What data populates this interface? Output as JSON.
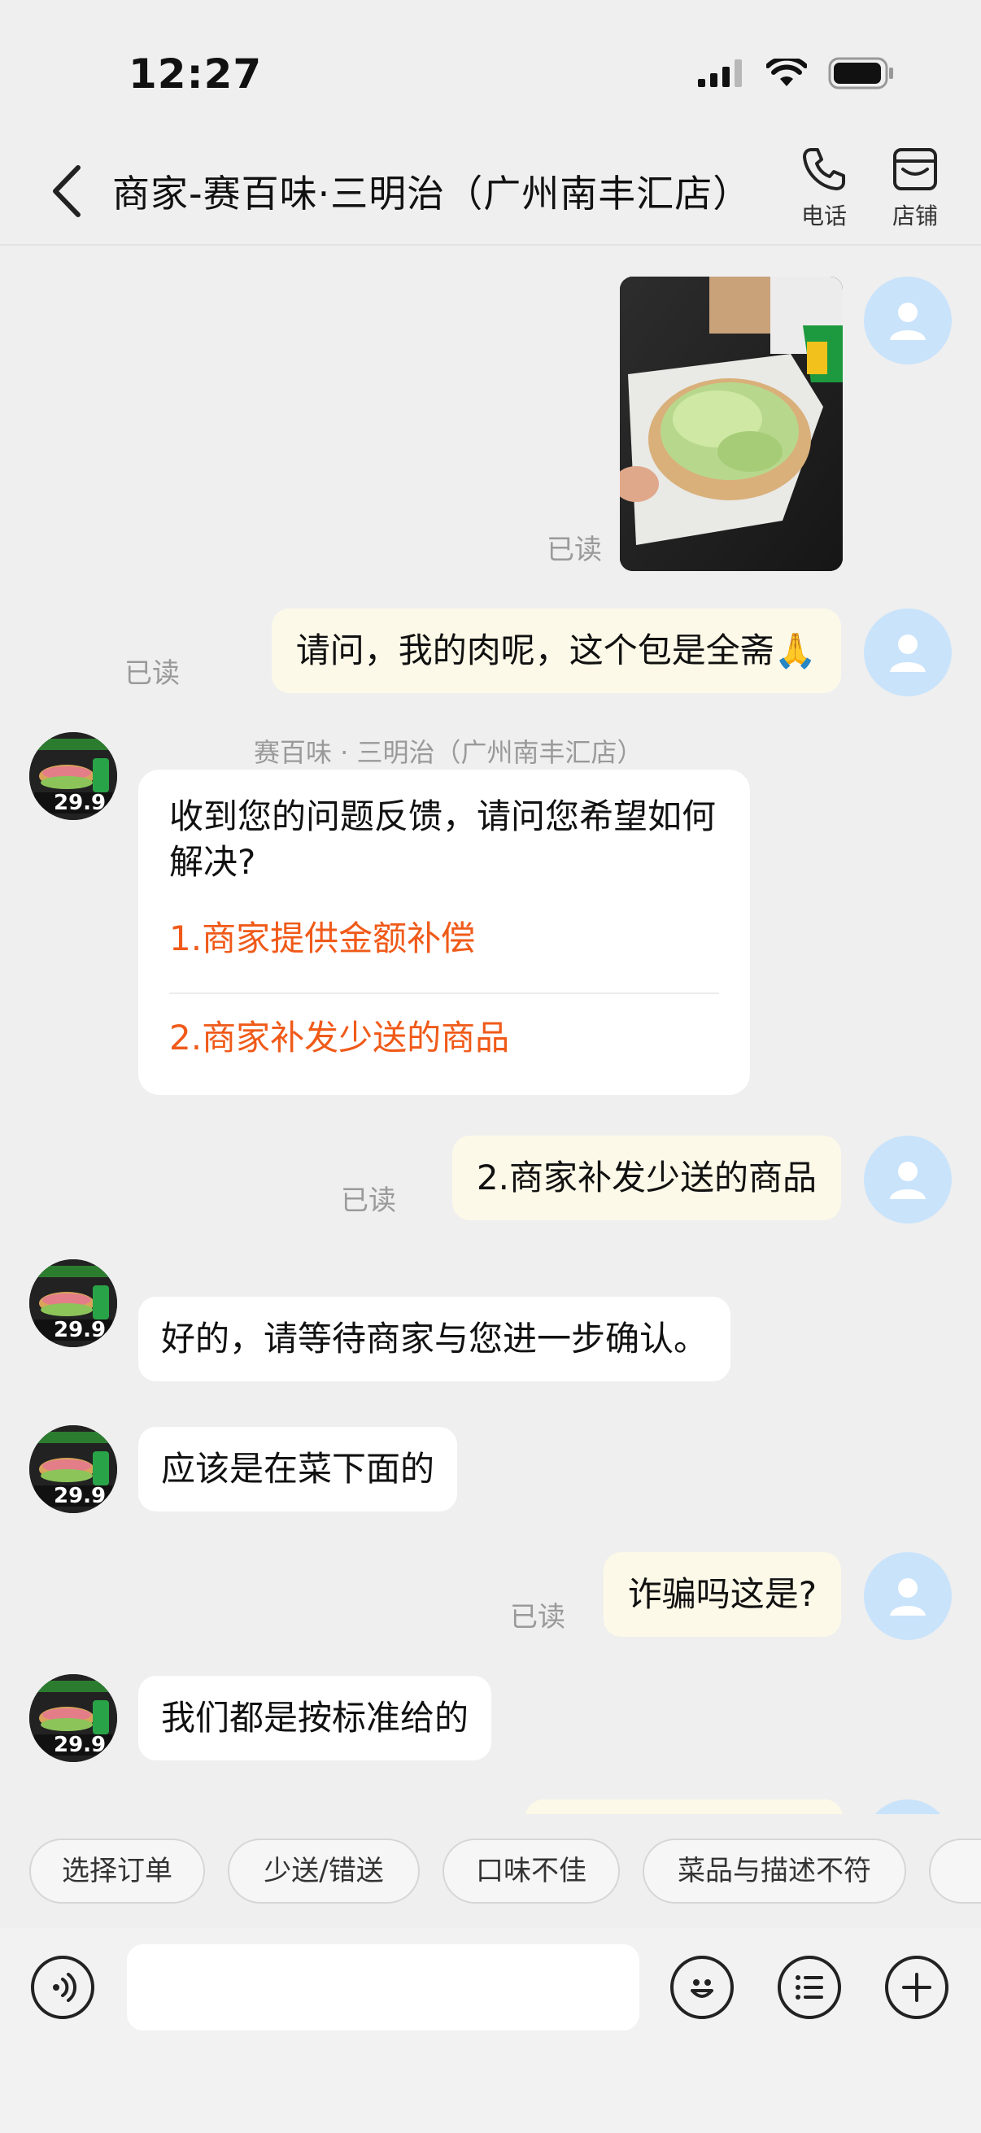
{
  "status_bar": {
    "time": "12:27"
  },
  "header": {
    "title": "商家-赛百味·三明治（广州南丰汇店）",
    "call_label": "电话",
    "shop_label": "店铺"
  },
  "chat": {
    "read_label": "已读",
    "messages": [
      {
        "from": "user",
        "kind": "image",
        "read": "已读"
      },
      {
        "from": "user",
        "text": "请问，我的肉呢，这个包是全斋🙏",
        "read": "已读"
      },
      {
        "from": "shop",
        "kind": "card",
        "sender": "赛百味 · 三明治（广州南丰汇店）",
        "question": "收到您的问题反馈，请问您希望如何解决?",
        "options": [
          "1.商家提供金额补偿",
          "2.商家补发少送的商品"
        ]
      },
      {
        "from": "user",
        "text": "2.商家补发少送的商品",
        "read": "已读"
      },
      {
        "from": "shop",
        "text": "好的，请等待商家与您进一步确认。"
      },
      {
        "from": "shop",
        "text": "应该是在菜下面的"
      },
      {
        "from": "user",
        "text": "诈骗吗这是?",
        "read": "已读"
      },
      {
        "from": "shop",
        "text": "我们都是按标准给的"
      }
    ],
    "shop_avatar_price": "29.9"
  },
  "quick_tags": [
    "选择订单",
    "少送/错送",
    "口味不佳",
    "菜品与描述不符"
  ],
  "input": {
    "value": "",
    "placeholder": ""
  },
  "colors": {
    "background": "#efefef",
    "user_bubble": "#fdf9e8",
    "accent_orange": "#f05a19",
    "user_avatar": "#c9e3fb"
  },
  "icons": [
    "signal-icon",
    "wifi-icon",
    "battery-icon",
    "back-icon",
    "phone-icon",
    "shop-icon",
    "voice-icon",
    "emoji-icon",
    "more-options-icon",
    "add-icon"
  ]
}
